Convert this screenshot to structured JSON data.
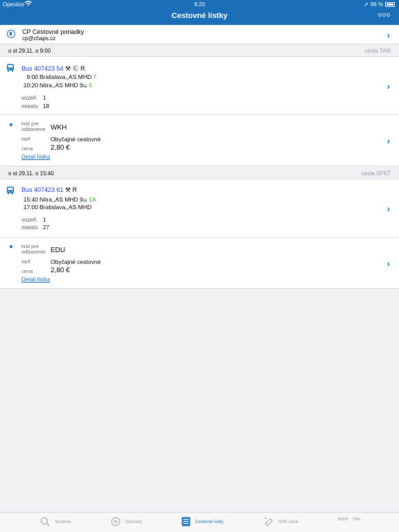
{
  "status": {
    "carrier": "Operátor",
    "time": "9:20",
    "battery": "96 %"
  },
  "nav": {
    "title": "Cestovné lístky",
    "more": "ooo"
  },
  "account": {
    "name": "CP Cestovné poriadky",
    "email": "cp@chaps.cz"
  },
  "trips": [
    {
      "header_left": "o st 29.11. o 9:00",
      "header_right": "cesta TAM",
      "bus": {
        "number": "Bus 407423 54",
        "symbols": "⚒ Ⓒ R"
      },
      "stops": [
        {
          "time": "9:00",
          "name": "Bratislava,,AS MHD",
          "extra": "7"
        },
        {
          "time": "10:20",
          "name": "Nitra,,AS MHD",
          "extra": "5"
        }
      ],
      "vozen_label": "vozeň",
      "vozen": "1",
      "miesto_label": "miesto",
      "miesto": "18",
      "ticket": {
        "code_label": "kód pre odbavenie",
        "code": "WKH",
        "tarif_label": "tarif",
        "tarif": "Obyčajné cestovné",
        "cena_label": "cena",
        "cena": "2,80 €",
        "detail": "Detail lístka"
      }
    },
    {
      "header_left": "o st 29.11. o 15:40",
      "header_right": "cesta SPÄŤ",
      "bus": {
        "number": "Bus 407423 61",
        "symbols": "⚒ R"
      },
      "stops": [
        {
          "time": "15:40",
          "name": "Nitra,,AS MHD",
          "extra": "1A"
        },
        {
          "time": "17:00",
          "name": "Bratislava,,AS MHD",
          "extra": ""
        }
      ],
      "vozen_label": "vozeň",
      "vozen": "1",
      "miesto_label": "miesto",
      "miesto": "27",
      "ticket": {
        "code_label": "kód pre odbavenie",
        "code": "EDU",
        "tarif_label": "tarif",
        "tarif": "Obyčajné cestovné",
        "cena_label": "cena",
        "cena": "2,80 €",
        "detail": "Detail lístka"
      }
    }
  ],
  "tabs": [
    {
      "label": "Spojenia",
      "icon": "search-icon"
    },
    {
      "label": "Odchody",
      "icon": "clock-icon"
    },
    {
      "label": "Cestovné lístky",
      "icon": "ticket-icon",
      "active": true
    },
    {
      "label": "SMS lístok",
      "icon": "sms-ticket-icon"
    },
    {
      "label": "Viac",
      "icon": "more-icon"
    }
  ],
  "colors": {
    "accent": "#1a6fb8",
    "bus_number": "#1a3fd0",
    "platform": "#2aa82a"
  }
}
